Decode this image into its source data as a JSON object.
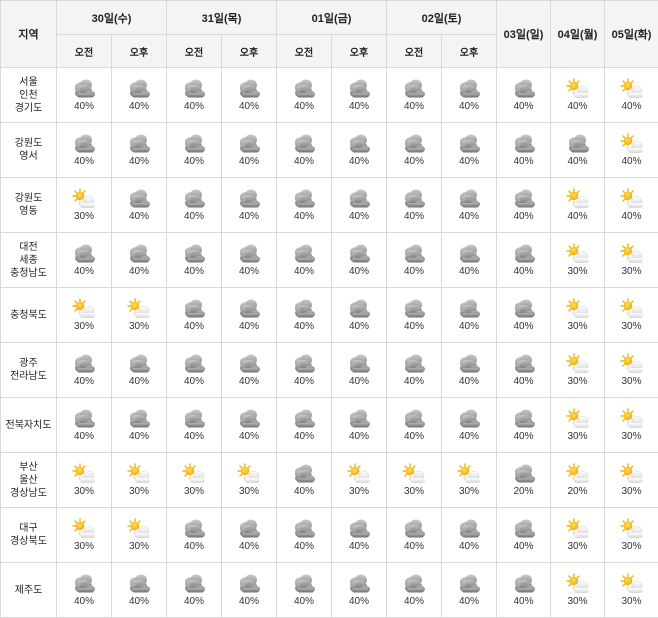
{
  "header": {
    "region_label": "지역",
    "days": [
      {
        "label": "30일(수)",
        "split": true
      },
      {
        "label": "31일(목)",
        "split": true
      },
      {
        "label": "01일(금)",
        "split": true
      },
      {
        "label": "02일(토)",
        "split": true
      },
      {
        "label": "03일(일)",
        "split": false
      },
      {
        "label": "04일(월)",
        "split": false
      },
      {
        "label": "05일(화)",
        "split": false
      }
    ],
    "am_label": "오전",
    "pm_label": "오후"
  },
  "icons": {
    "cloudy": "cloudy-icon",
    "partly_cloudy": "partly-cloudy-icon"
  },
  "rows": [
    {
      "region": [
        "서울",
        "인천",
        "경기도"
      ],
      "cells": [
        [
          "cloudy",
          "40%"
        ],
        [
          "cloudy",
          "40%"
        ],
        [
          "cloudy",
          "40%"
        ],
        [
          "cloudy",
          "40%"
        ],
        [
          "cloudy",
          "40%"
        ],
        [
          "cloudy",
          "40%"
        ],
        [
          "cloudy",
          "40%"
        ],
        [
          "cloudy",
          "40%"
        ],
        [
          "cloudy",
          "40%"
        ],
        [
          "partly_cloudy",
          "40%"
        ],
        [
          "partly_cloudy",
          "40%"
        ]
      ]
    },
    {
      "region": [
        "강원도",
        "영서"
      ],
      "cells": [
        [
          "cloudy",
          "40%"
        ],
        [
          "cloudy",
          "40%"
        ],
        [
          "cloudy",
          "40%"
        ],
        [
          "cloudy",
          "40%"
        ],
        [
          "cloudy",
          "40%"
        ],
        [
          "cloudy",
          "40%"
        ],
        [
          "cloudy",
          "40%"
        ],
        [
          "cloudy",
          "40%"
        ],
        [
          "cloudy",
          "40%"
        ],
        [
          "cloudy",
          "40%"
        ],
        [
          "partly_cloudy",
          "40%"
        ]
      ]
    },
    {
      "region": [
        "강원도",
        "영동"
      ],
      "cells": [
        [
          "partly_cloudy",
          "30%"
        ],
        [
          "cloudy",
          "40%"
        ],
        [
          "cloudy",
          "40%"
        ],
        [
          "cloudy",
          "40%"
        ],
        [
          "cloudy",
          "40%"
        ],
        [
          "cloudy",
          "40%"
        ],
        [
          "cloudy",
          "40%"
        ],
        [
          "cloudy",
          "40%"
        ],
        [
          "cloudy",
          "40%"
        ],
        [
          "partly_cloudy",
          "40%"
        ],
        [
          "partly_cloudy",
          "40%"
        ]
      ]
    },
    {
      "region": [
        "대전",
        "세종",
        "충청남도"
      ],
      "cells": [
        [
          "cloudy",
          "40%"
        ],
        [
          "cloudy",
          "40%"
        ],
        [
          "cloudy",
          "40%"
        ],
        [
          "cloudy",
          "40%"
        ],
        [
          "cloudy",
          "40%"
        ],
        [
          "cloudy",
          "40%"
        ],
        [
          "cloudy",
          "40%"
        ],
        [
          "cloudy",
          "40%"
        ],
        [
          "cloudy",
          "40%"
        ],
        [
          "partly_cloudy",
          "30%"
        ],
        [
          "partly_cloudy",
          "30%"
        ]
      ]
    },
    {
      "region": [
        "충청북도"
      ],
      "cells": [
        [
          "partly_cloudy",
          "30%"
        ],
        [
          "partly_cloudy",
          "30%"
        ],
        [
          "cloudy",
          "40%"
        ],
        [
          "cloudy",
          "40%"
        ],
        [
          "cloudy",
          "40%"
        ],
        [
          "cloudy",
          "40%"
        ],
        [
          "cloudy",
          "40%"
        ],
        [
          "cloudy",
          "40%"
        ],
        [
          "cloudy",
          "40%"
        ],
        [
          "partly_cloudy",
          "30%"
        ],
        [
          "partly_cloudy",
          "30%"
        ]
      ]
    },
    {
      "region": [
        "광주",
        "전라남도"
      ],
      "cells": [
        [
          "cloudy",
          "40%"
        ],
        [
          "cloudy",
          "40%"
        ],
        [
          "cloudy",
          "40%"
        ],
        [
          "cloudy",
          "40%"
        ],
        [
          "cloudy",
          "40%"
        ],
        [
          "cloudy",
          "40%"
        ],
        [
          "cloudy",
          "40%"
        ],
        [
          "cloudy",
          "40%"
        ],
        [
          "cloudy",
          "40%"
        ],
        [
          "partly_cloudy",
          "30%"
        ],
        [
          "partly_cloudy",
          "30%"
        ]
      ]
    },
    {
      "region": [
        "전북자치도"
      ],
      "cells": [
        [
          "cloudy",
          "40%"
        ],
        [
          "cloudy",
          "40%"
        ],
        [
          "cloudy",
          "40%"
        ],
        [
          "cloudy",
          "40%"
        ],
        [
          "cloudy",
          "40%"
        ],
        [
          "cloudy",
          "40%"
        ],
        [
          "cloudy",
          "40%"
        ],
        [
          "cloudy",
          "40%"
        ],
        [
          "cloudy",
          "40%"
        ],
        [
          "partly_cloudy",
          "30%"
        ],
        [
          "partly_cloudy",
          "30%"
        ]
      ]
    },
    {
      "region": [
        "부산",
        "울산",
        "경상남도"
      ],
      "cells": [
        [
          "partly_cloudy",
          "30%"
        ],
        [
          "partly_cloudy",
          "30%"
        ],
        [
          "partly_cloudy",
          "30%"
        ],
        [
          "partly_cloudy",
          "30%"
        ],
        [
          "cloudy",
          "40%"
        ],
        [
          "partly_cloudy",
          "30%"
        ],
        [
          "partly_cloudy",
          "30%"
        ],
        [
          "partly_cloudy",
          "30%"
        ],
        [
          "cloudy",
          "20%"
        ],
        [
          "partly_cloudy",
          "20%"
        ],
        [
          "partly_cloudy",
          "30%"
        ]
      ]
    },
    {
      "region": [
        "대구",
        "경상북도"
      ],
      "cells": [
        [
          "partly_cloudy",
          "30%"
        ],
        [
          "partly_cloudy",
          "30%"
        ],
        [
          "cloudy",
          "40%"
        ],
        [
          "cloudy",
          "40%"
        ],
        [
          "cloudy",
          "40%"
        ],
        [
          "cloudy",
          "40%"
        ],
        [
          "cloudy",
          "40%"
        ],
        [
          "cloudy",
          "40%"
        ],
        [
          "cloudy",
          "40%"
        ],
        [
          "partly_cloudy",
          "30%"
        ],
        [
          "partly_cloudy",
          "30%"
        ]
      ]
    },
    {
      "region": [
        "제주도"
      ],
      "cells": [
        [
          "cloudy",
          "40%"
        ],
        [
          "cloudy",
          "40%"
        ],
        [
          "cloudy",
          "40%"
        ],
        [
          "cloudy",
          "40%"
        ],
        [
          "cloudy",
          "40%"
        ],
        [
          "cloudy",
          "40%"
        ],
        [
          "cloudy",
          "40%"
        ],
        [
          "cloudy",
          "40%"
        ],
        [
          "cloudy",
          "40%"
        ],
        [
          "partly_cloudy",
          "30%"
        ],
        [
          "partly_cloudy",
          "30%"
        ]
      ]
    }
  ]
}
